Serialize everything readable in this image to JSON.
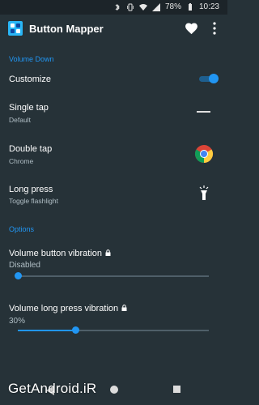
{
  "status_bar": {
    "battery": "78%",
    "time": "10:23"
  },
  "app": {
    "title": "Button Mapper"
  },
  "sections": {
    "volume_down": "Volume Down",
    "options": "Options"
  },
  "rows": {
    "customize": {
      "title": "Customize",
      "enabled": true
    },
    "single_tap": {
      "title": "Single tap",
      "summary": "Default"
    },
    "double_tap": {
      "title": "Double tap",
      "summary": "Chrome"
    },
    "long_press": {
      "title": "Long press",
      "summary": "Toggle flashlight"
    }
  },
  "options": {
    "vibration": {
      "title": "Volume button vibration",
      "value": "Disabled",
      "level": 0
    },
    "long_press_vibration": {
      "title": "Volume long press vibration",
      "value": "30%",
      "level": 0.3
    }
  },
  "watermark": "GetAndroid.iR",
  "colors": {
    "accent": "#2196f3",
    "background": "#263238"
  }
}
